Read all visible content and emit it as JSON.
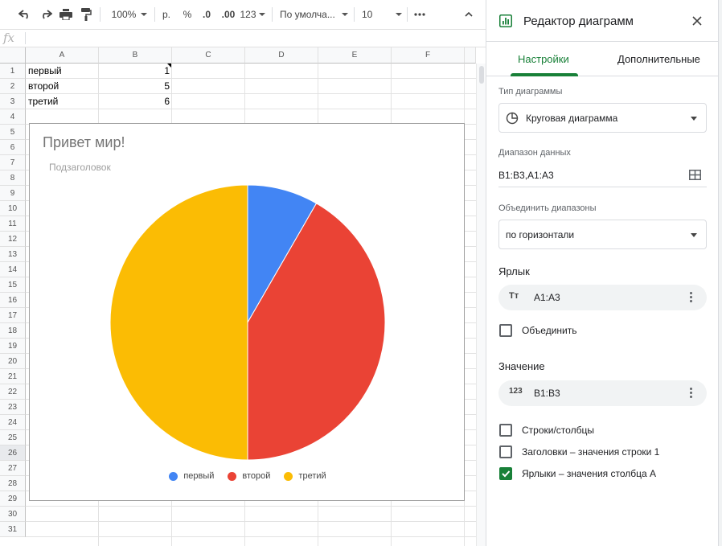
{
  "toolbar": {
    "zoom": "100%",
    "currency": "р.",
    "percent": "%",
    "decrease_decimals": ".0",
    "increase_decimals": ".00",
    "number_format": "123",
    "font": "По умолча...",
    "font_size": "10"
  },
  "formula_bar": {
    "fx": "fx"
  },
  "columns": [
    "A",
    "B",
    "C",
    "D",
    "E",
    "F"
  ],
  "rows": [
    "1",
    "2",
    "3",
    "4",
    "5",
    "6",
    "7",
    "8",
    "9",
    "10",
    "11",
    "12",
    "13",
    "14",
    "15",
    "16",
    "17",
    "18",
    "19",
    "20",
    "21",
    "22",
    "23",
    "24",
    "25",
    "26",
    "27",
    "28",
    "29",
    "30",
    "31"
  ],
  "cells": [
    {
      "label": "первый",
      "value": "1"
    },
    {
      "label": "второй",
      "value": "5"
    },
    {
      "label": "третий",
      "value": "6"
    }
  ],
  "chart_data": {
    "type": "pie",
    "title": "Привет мир!",
    "subtitle": "Подзаголовок",
    "categories": [
      "первый",
      "второй",
      "третий"
    ],
    "values": [
      1,
      5,
      6
    ],
    "colors": [
      "#4285f4",
      "#ea4335",
      "#fbbc04"
    ],
    "legend_position": "bottom"
  },
  "panel": {
    "title": "Редактор диаграмм",
    "tabs": [
      "Настройки",
      "Дополнительные"
    ],
    "chart_type_label": "Тип диаграммы",
    "chart_type_value": "Круговая диаграмма",
    "data_range_label": "Диапазон данных",
    "data_range_value": "B1:B3,A1:A3",
    "combine_label": "Объединить диапазоны",
    "combine_value": "по горизонтали",
    "label_section": "Ярлык",
    "label_range": "A1:A3",
    "label_icon": "Tт",
    "aggregate_label": "Объединить",
    "value_section": "Значение",
    "value_range": "B1:B3",
    "value_icon": "123",
    "checkbox_rows_cols": "Строки/столбцы",
    "checkbox_headers": "Заголовки – значения строки 1",
    "checkbox_labels": "Ярлыки – значения столбца А",
    "checkbox_labels_checked": true
  }
}
